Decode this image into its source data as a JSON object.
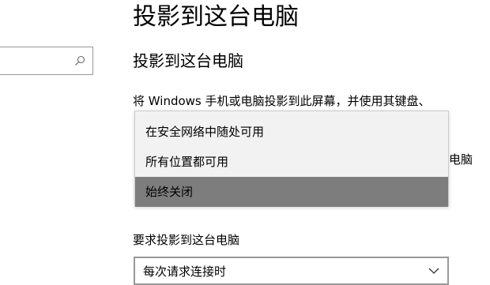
{
  "page": {
    "title": "投影到这台电脑"
  },
  "search": {
    "value": "",
    "placeholder": ""
  },
  "section": {
    "heading": "投影到这台电脑",
    "description": "将 Windows 手机或电脑投影到此屏幕，并使用其键盘、",
    "trailing_text": "电脑"
  },
  "dropdown": {
    "options": [
      {
        "label": "在安全网络中随处可用"
      },
      {
        "label": "所有位置都可用"
      },
      {
        "label": "始终关闭",
        "selected": true
      }
    ]
  },
  "require_projection": {
    "label": "要求投影到这台电脑",
    "selected_value": "每次请求连接时"
  },
  "colors": {
    "selected_option_background": "#7d7d7d",
    "dropdown_background": "#f2f2f2",
    "field_border": "#999999"
  },
  "icons": {
    "search": "search-icon",
    "dropdown_arrow": "chevron-down-icon"
  }
}
